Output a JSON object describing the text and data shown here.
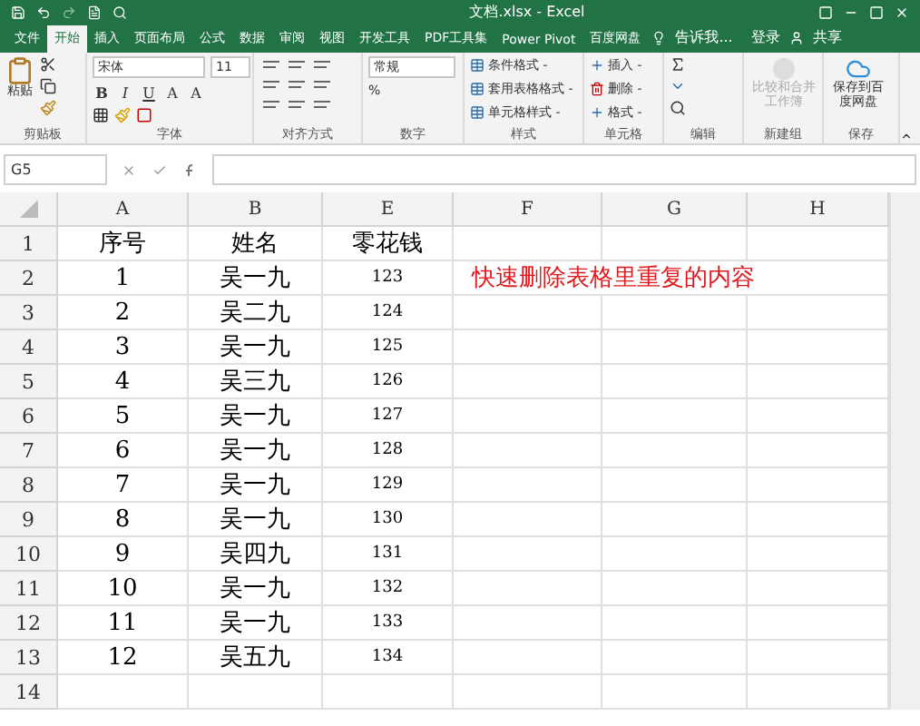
{
  "window": {
    "title": "文档.xlsx - Excel"
  },
  "tabs": [
    {
      "label": "文件",
      "selected": false
    },
    {
      "label": "开始",
      "selected": true
    },
    {
      "label": "插入",
      "selected": false
    },
    {
      "label": "页面布局",
      "selected": false
    },
    {
      "label": "公式",
      "selected": false
    },
    {
      "label": "数据",
      "selected": false
    },
    {
      "label": "审阅",
      "selected": false
    },
    {
      "label": "视图",
      "selected": false
    },
    {
      "label": "开发工具",
      "selected": false
    },
    {
      "label": "PDF工具集",
      "selected": false
    },
    {
      "label": "Power Pivot",
      "selected": false
    },
    {
      "label": "百度网盘",
      "selected": false
    }
  ],
  "tell_me": "告诉我...",
  "sign_in": "登录",
  "share": "共享",
  "ribbon": {
    "paste": "粘贴",
    "font": "宋体",
    "font_size": "11",
    "bold": "B",
    "italic": "I",
    "underline": "U",
    "grow": "A",
    "shrink": "A",
    "number_format": "常规",
    "percent": "%",
    "styles": [
      "条件格式 -",
      "套用表格格式 -",
      "单元格样式 -"
    ],
    "cells": [
      "插入 -",
      "删除 -",
      "格式 -"
    ],
    "compare": "比较和合并工作簿",
    "save_to": "保存到百度网盘",
    "groups": [
      "剪贴板",
      "字体",
      "对齐方式",
      "数字",
      "样式",
      "单元格",
      "编辑",
      "新建组",
      "保存"
    ]
  },
  "name_box": "G5",
  "sheet": {
    "columns": [
      "A",
      "B",
      "E",
      "F",
      "G",
      "H"
    ],
    "rows": [
      {
        "num": "1",
        "cells": [
          "序号",
          "姓名",
          "零花钱",
          ""
        ]
      },
      {
        "num": "2",
        "cells": [
          "1",
          "吴一九",
          "123",
          "快速删除表格里重复的内容"
        ]
      },
      {
        "num": "3",
        "cells": [
          "2",
          "吴二九",
          "124",
          ""
        ]
      },
      {
        "num": "4",
        "cells": [
          "3",
          "吴一九",
          "125",
          ""
        ]
      },
      {
        "num": "5",
        "cells": [
          "4",
          "吴三九",
          "126",
          ""
        ]
      },
      {
        "num": "6",
        "cells": [
          "5",
          "吴一九",
          "127",
          ""
        ]
      },
      {
        "num": "7",
        "cells": [
          "6",
          "吴一九",
          "128",
          ""
        ]
      },
      {
        "num": "8",
        "cells": [
          "7",
          "吴一九",
          "129",
          ""
        ]
      },
      {
        "num": "9",
        "cells": [
          "8",
          "吴一九",
          "130",
          ""
        ]
      },
      {
        "num": "10",
        "cells": [
          "9",
          "吴四九",
          "131",
          ""
        ]
      },
      {
        "num": "11",
        "cells": [
          "10",
          "吴一九",
          "132",
          ""
        ]
      },
      {
        "num": "12",
        "cells": [
          "11",
          "吴一九",
          "133",
          ""
        ]
      },
      {
        "num": "13",
        "cells": [
          "12",
          "吴五九",
          "134",
          ""
        ]
      },
      {
        "num": "14",
        "cells": [
          "",
          "",
          "",
          ""
        ]
      }
    ]
  }
}
